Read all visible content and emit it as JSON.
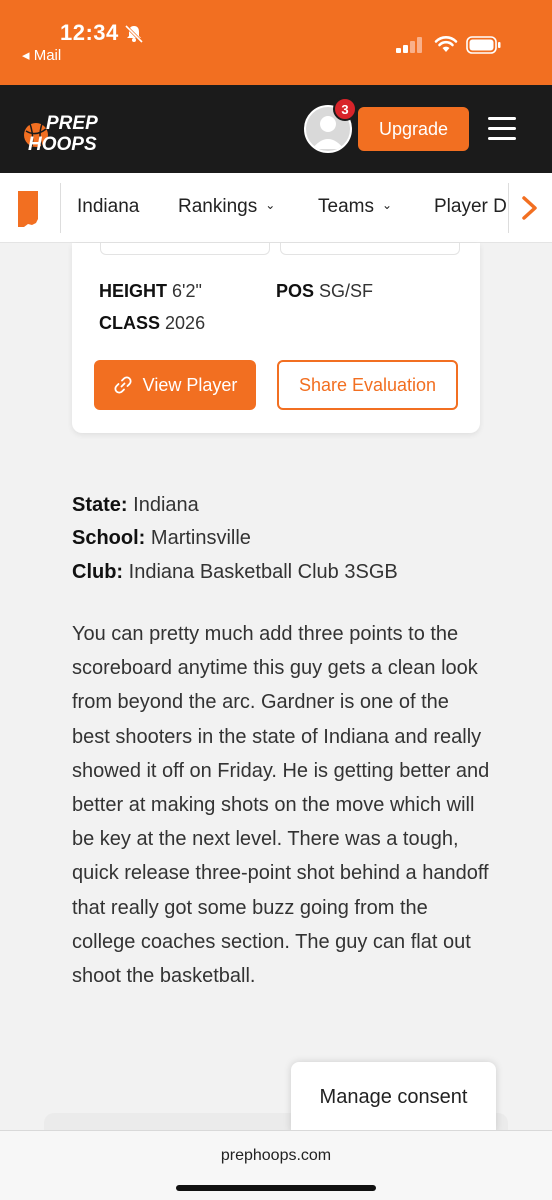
{
  "status_bar": {
    "time": "12:34",
    "back_label": "◂ Mail"
  },
  "header": {
    "logo_text_line1": "PREP",
    "logo_text_line2": "HOOPS",
    "notification_count": "3",
    "upgrade_label": "Upgrade"
  },
  "sub_nav": {
    "items": [
      {
        "label": "Indiana"
      },
      {
        "label": "Rankings"
      },
      {
        "label": "Teams"
      },
      {
        "label": "Player D"
      }
    ]
  },
  "player_card": {
    "height_label": "HEIGHT",
    "height_value": "6'2\"",
    "pos_label": "POS",
    "pos_value": "SG/SF",
    "class_label": "CLASS",
    "class_value": "2026",
    "view_player_label": "View Player",
    "share_label": "Share Evaluation"
  },
  "details": {
    "state_label": "State:",
    "state_value": "Indiana",
    "school_label": "School:",
    "school_value": "Martinsville",
    "club_label": "Club:",
    "club_value": "Indiana Basketball Club 3SGB"
  },
  "evaluation": "You can pretty much add three points to the scoreboard anytime this guy gets a clean look from beyond the arc. Gardner is one of the best shooters in the state of Indiana and really showed it off on Friday. He is getting better and better at making shots on the move which will be key at the next level. There was a tough, quick release three-point shot behind a handoff that really got some buzz going from the college coaches section. The guy can flat out shoot the basketball.",
  "consent_label": "Manage consent",
  "browser": {
    "url": "prephoops.com"
  },
  "colors": {
    "brand_orange": "#f26f21",
    "header_dark": "#1b1b1b",
    "badge_red": "#d8242a"
  }
}
